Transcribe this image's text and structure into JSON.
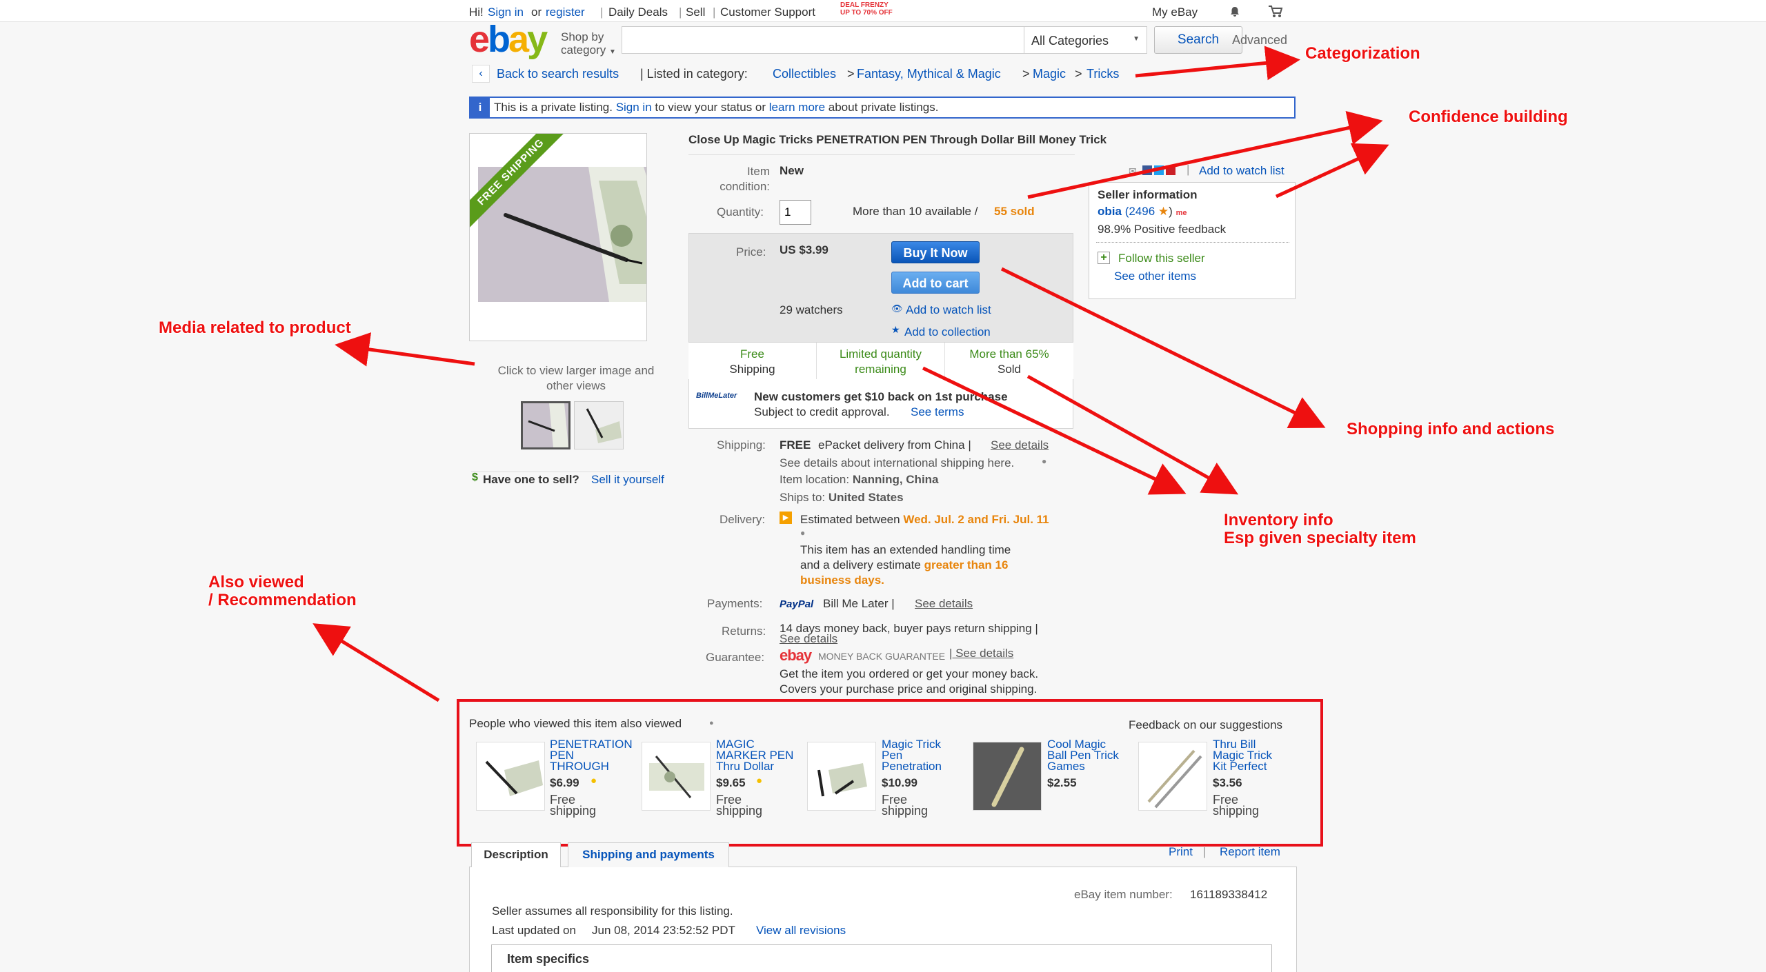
{
  "header": {
    "greeting": "Hi!",
    "sign_in": "Sign in",
    "or": "or",
    "register": "register",
    "daily_deals": "Daily Deals",
    "sell": "Sell",
    "customer_support": "Customer Support",
    "deal_frenzy_1": "DEAL FRENZY",
    "deal_frenzy_2": "UP TO 70% OFF",
    "my_ebay": "My eBay",
    "logo_letters": [
      "e",
      "b",
      "a",
      "y"
    ],
    "shop_by_1": "Shop by",
    "shop_by_2": "category",
    "search_value": "",
    "category_select": "All Categories",
    "search_button": "Search",
    "advanced": "Advanced"
  },
  "breadcrumb": {
    "back": "Back to search results",
    "listed_in": "| Listed in category:",
    "items": [
      "Collectibles",
      "Fantasy, Mythical & Magic",
      "Magic",
      "Tricks"
    ],
    "separator": ">"
  },
  "notice": {
    "icon": "i",
    "text_1": "This is a private listing.",
    "sign_in": "Sign in",
    "text_2": "to view your status or",
    "learn_more": "learn more",
    "text_3": "about private listings."
  },
  "media": {
    "ribbon": "FREE SHIPPING",
    "caption": "Click to view larger image and other views",
    "have_one": "Have one to sell?",
    "sell_it": "Sell it yourself"
  },
  "item": {
    "title": "Close Up Magic Tricks PENETRATION PEN Through Dollar Bill Money Trick",
    "condition_label_1": "Item",
    "condition_label_2": "condition:",
    "condition_value": "New",
    "quantity_label": "Quantity:",
    "quantity_value": "1",
    "available": "More than 10 available /",
    "sold": "55 sold",
    "price_label": "Price:",
    "price_value": "US $3.99",
    "buy_now": "Buy It Now",
    "add_cart": "Add to cart",
    "watchers": "29 watchers",
    "add_watch": "Add to watch list",
    "add_collection": "Add to collection",
    "badges": [
      {
        "line1": "Free",
        "line2": "Shipping"
      },
      {
        "line1": "Limited quantity",
        "line2": "remaining"
      },
      {
        "line1": "More than 65%",
        "line2": "Sold"
      }
    ],
    "bml_logo": "BillMeLater",
    "bml_headline": "New customers get $10 back on 1st purchase",
    "bml_sub": "Subject to credit approval.",
    "bml_terms": "See terms"
  },
  "seller": {
    "add_watch": "Add to watch list",
    "title": "Seller information",
    "name": "obia",
    "score": "(2496",
    "star": "★",
    "close_paren": ")",
    "me": "me",
    "positive": "98.9% Positive feedback",
    "follow": "Follow this seller",
    "other_items": "See other items"
  },
  "details": {
    "shipping_label": "Shipping:",
    "shipping_free": "FREE",
    "shipping_text": "ePacket delivery from China |",
    "shipping_see": "See details",
    "shipping_intl": "See details about international shipping here.",
    "location_label": "Item location:",
    "location_value": "Nanning, China",
    "ships_label": "Ships to:",
    "ships_value": "United States",
    "delivery_label": "Delivery:",
    "delivery_est": "Estimated between",
    "delivery_dates": "Wed. Jul. 2 and Fri. Jul. 11",
    "delivery_ext_1": "This item has an extended handling time",
    "delivery_ext_2": "and a delivery estimate",
    "delivery_ext_3": "greater than 16",
    "delivery_ext_4": "business days.",
    "payments_label": "Payments:",
    "payments_paypal": "PayPal",
    "payments_bml": "Bill Me Later |",
    "payments_see": "See details",
    "returns_label": "Returns:",
    "returns_text": "14 days money back, buyer pays return shipping |",
    "returns_see": "See details",
    "guarantee_label": "Guarantee:",
    "guarantee_logo": "ebay",
    "guarantee_mbg": "MONEY BACK GUARANTEE",
    "guarantee_see": "| See details",
    "guarantee_1": "Get the item you ordered or get your money back.",
    "guarantee_2": "Covers your purchase price and original shipping."
  },
  "recommendations": {
    "heading": "People who viewed this item also viewed",
    "feedback": "Feedback on our suggestions",
    "items": [
      {
        "title_1": "PENETRATION",
        "title_2": "PEN",
        "title_3": "THROUGH",
        "price": "$6.99",
        "ship_1": "Free",
        "ship_2": "shipping"
      },
      {
        "title_1": "MAGIC",
        "title_2": "MARKER PEN",
        "title_3": "Thru Dollar",
        "price": "$9.65",
        "ship_1": "Free",
        "ship_2": "shipping"
      },
      {
        "title_1": "Magic Trick",
        "title_2": "Pen",
        "title_3": "Penetration",
        "price": "$10.99",
        "ship_1": "Free",
        "ship_2": "shipping"
      },
      {
        "title_1": "Cool Magic",
        "title_2": "Ball Pen Trick",
        "title_3": "Games",
        "price": "$2.55",
        "ship_1": "",
        "ship_2": ""
      },
      {
        "title_1": "Thru Bill",
        "title_2": "Magic Trick",
        "title_3": "Kit Perfect",
        "price": "$3.56",
        "ship_1": "Free",
        "ship_2": "shipping"
      }
    ]
  },
  "description": {
    "tab_desc": "Description",
    "tab_ship": "Shipping and payments",
    "print": "Print",
    "report": "Report item",
    "item_number_label": "eBay item number:",
    "item_number": "161189338412",
    "responsibility": "Seller assumes all responsibility for this listing.",
    "updated_label": "Last updated on",
    "updated_value": "Jun 08, 2014 23:52:52 PDT",
    "revisions": "View all revisions",
    "specifics": "Item specifics"
  },
  "annotations": {
    "categorization": "Categorization",
    "confidence": "Confidence building",
    "media": "Media related to product",
    "shopping": "Shopping info and actions",
    "inventory_1": "Inventory info",
    "inventory_2": "Esp given specialty item",
    "also_1": "Also viewed",
    "also_2": "/ Recommendation"
  },
  "colors": {
    "link": "#0654ba",
    "annotation": "#ee1010",
    "orange": "#e8850c",
    "green": "#3a8a17"
  }
}
